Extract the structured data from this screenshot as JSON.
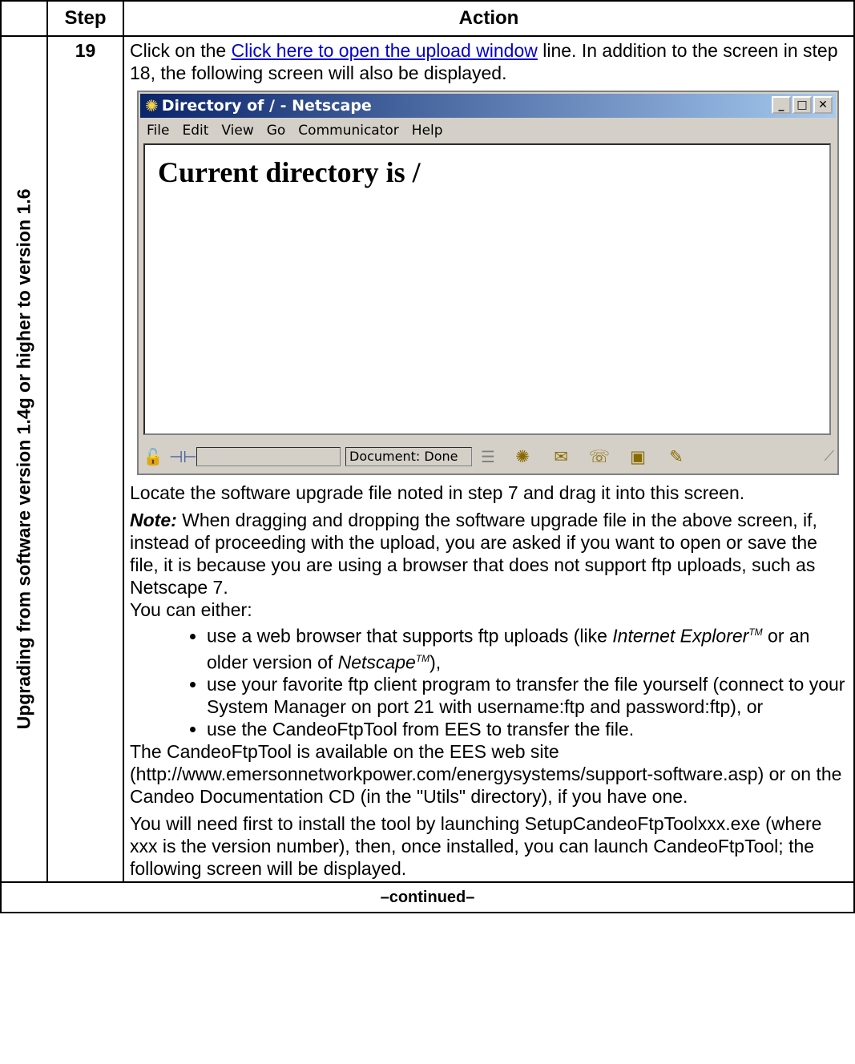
{
  "header": {
    "step_col": "Step",
    "action_col": "Action"
  },
  "side_label": "Upgrading from software version 1.4g or higher to version 1.6",
  "step_number": "19",
  "intro": {
    "prefix": "Click on the ",
    "link": "Click here to open the upload window",
    "suffix": " line. In addition to the screen in step 18, the following screen will also be displayed."
  },
  "window": {
    "title": "Directory of / - Netscape",
    "buttons": {
      "minimize": "_",
      "maximize": "□",
      "close": "✕"
    },
    "menu": [
      "File",
      "Edit",
      "View",
      "Go",
      "Communicator",
      "Help"
    ],
    "heading": "Current directory is /",
    "status": "Document: Done"
  },
  "locate": "Locate the software upgrade file noted in step 7 and drag it into this screen.",
  "note": {
    "label": "Note:",
    "text": " When dragging and dropping the software upgrade file in the above screen, if, instead of proceeding with the upload, you are asked if you want to open or save the file, it is because you are using a browser that does not support ftp uploads, such as Netscape 7."
  },
  "either": "You can either:",
  "options": {
    "o1_a": "use a web browser that supports ftp uploads (like ",
    "o1_ie": "Internet Explorer",
    "o1_tm": "TM",
    "o1_b": " or an older version of ",
    "o1_ns": "Netscape",
    "o1_tm2": "TM",
    "o1_c": "),",
    "o2": "use your favorite ftp client program to transfer the file yourself (connect to your System Manager on port 21 with username:ftp and password:ftp), or",
    "o3": "use the CandeoFtpTool from EES to transfer the file."
  },
  "tool_para": "The CandeoFtpTool is available on the EES web site (http://www.emersonnetworkpower.com/energysystems/support-software.asp) or on the Candeo Documentation CD (in the \"Utils\" directory), if you have one.",
  "install_para": "You will need first to install the tool by launching SetupCandeoFtpToolxxx.exe (where xxx is the version number), then, once installed, you can launch CandeoFtpTool; the following screen will be displayed.",
  "footer": "–continued–"
}
